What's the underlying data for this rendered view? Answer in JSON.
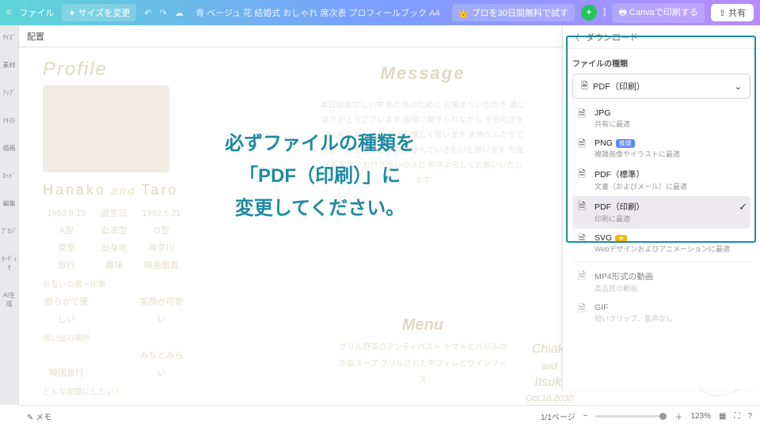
{
  "topbar": {
    "file": "ファイル",
    "resize": "サイズを変更",
    "title": "青 ベージュ 花 結婚式 おしゃれ 席次表 プロフィールブック A4",
    "try_pro": "プロを30日間無料で試す",
    "print": "Canvaで印刷する",
    "share": "共有"
  },
  "leftnav": [
    "ｻｲｽﾞ",
    "素材",
    "ｱｯﾌﾟ",
    "ﾃｷｽﾄ",
    "描画",
    "ﾛｰﾄﾞ",
    "編集",
    "ﾌﾟﾛｼﾞ",
    "ｵｰﾃﾞｨｵ",
    "AI生成"
  ],
  "toolbar2": {
    "arrange": "配置"
  },
  "panel": {
    "back": "ダウンロード",
    "label": "ファイルの種類",
    "selected": "PDF（印刷）",
    "opts": [
      {
        "id": "jpg",
        "title": "JPG",
        "sub": "共有に最適",
        "badge": ""
      },
      {
        "id": "png",
        "title": "PNG",
        "sub": "複雑画像やイラストに最適",
        "badge": "推奨"
      },
      {
        "id": "pdfstd",
        "title": "PDF（標準）",
        "sub": "文書（およびメール）に最適",
        "badge": ""
      },
      {
        "id": "pdfprint",
        "title": "PDF（印刷）",
        "sub": "印刷に最適",
        "badge": "",
        "selected": true
      },
      {
        "id": "svg",
        "title": "SVG",
        "sub": "Webデザインおよびアニメーションに最適",
        "badge": "gold"
      },
      {
        "id": "mp4",
        "title": "MP4形式の動画",
        "sub": "高品質の動画",
        "badge": "",
        "dim": true
      },
      {
        "id": "gif",
        "title": "GIF",
        "sub": "短いクリップ、音声なし",
        "badge": "",
        "dim": true
      }
    ]
  },
  "overlay": {
    "l1": "必ずファイルの種類を",
    "l2": "「PDF（印刷）」に",
    "l3": "変更してください。"
  },
  "doc": {
    "profile": "Profile",
    "name1": "Hanako",
    "and": "and",
    "name2": "Taro",
    "rows": [
      [
        "1993.8.19",
        "誕生日",
        "1992.5.21"
      ],
      [
        "A型",
        "血液型",
        "O型"
      ],
      [
        "東京",
        "出身地",
        "神奈川"
      ],
      [
        "旅行",
        "趣味",
        "映画鑑賞"
      ]
    ],
    "q1": "お互いの第一印象",
    "a1l": "朗らかで優しい",
    "a1r": "笑顔が可愛い",
    "q2": "思い出の場所",
    "a2l": "韓国旅行",
    "a2r": "みなとみらい",
    "q3": "どんな家庭にしたい？",
    "msg_h": "Message",
    "msg_body": "本日はお忙しい中 私たちのために お集まりいただき 誠にありがとうございます\n皆様に見守られながら 今日の日を迎えられたことを 心より嬉しく思います\n未熟なふたりですが　手を取り合い 共に歩んでいきたいと思います\n今後とも末永いお付き合いのほど 何卒よろしくお願いいたします",
    "menu_h": "Menu",
    "menu": "グリル野菜のアンティパスト\nトマトとバジルの冷製スープ\nグリルされた牛フィレとワインソース",
    "chiaki": "Chiaki",
    "and2": "and",
    "itsuki": "Itsuki",
    "date": "Oct.18.2030"
  },
  "footer": {
    "memo": "メモ",
    "page": "1/1ページ",
    "zoom": "123%"
  }
}
